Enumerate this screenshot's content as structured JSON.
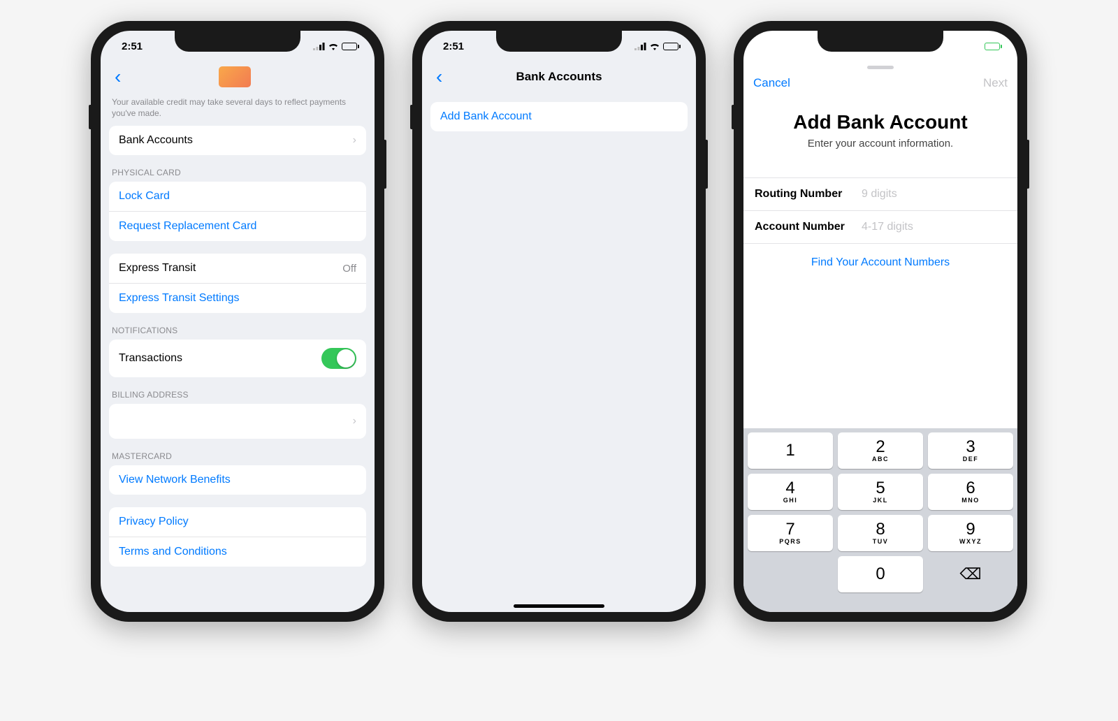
{
  "status": {
    "time": "2:51"
  },
  "screen1": {
    "helper_text": "Your available credit may take several days to reflect payments you've made.",
    "bank_accounts_label": "Bank Accounts",
    "sections": {
      "physical_card_header": "PHYSICAL CARD",
      "lock_card": "Lock Card",
      "request_replacement": "Request Replacement Card",
      "express_transit_label": "Express Transit",
      "express_transit_value": "Off",
      "express_transit_settings": "Express Transit Settings",
      "notifications_header": "NOTIFICATIONS",
      "transactions_label": "Transactions",
      "billing_header": "BILLING ADDRESS",
      "mastercard_header": "MASTERCARD",
      "network_benefits": "View Network Benefits",
      "privacy_policy": "Privacy Policy",
      "terms": "Terms and Conditions"
    }
  },
  "screen2": {
    "title": "Bank Accounts",
    "add_label": "Add Bank Account"
  },
  "screen3": {
    "cancel": "Cancel",
    "next": "Next",
    "title": "Add Bank Account",
    "subtitle": "Enter your account information.",
    "routing_label": "Routing Number",
    "routing_placeholder": "9 digits",
    "account_label": "Account Number",
    "account_placeholder": "4-17 digits",
    "help_link": "Find Your Account Numbers",
    "keypad": [
      {
        "num": "1",
        "sub": ""
      },
      {
        "num": "2",
        "sub": "ABC"
      },
      {
        "num": "3",
        "sub": "DEF"
      },
      {
        "num": "4",
        "sub": "GHI"
      },
      {
        "num": "5",
        "sub": "JKL"
      },
      {
        "num": "6",
        "sub": "MNO"
      },
      {
        "num": "7",
        "sub": "PQRS"
      },
      {
        "num": "8",
        "sub": "TUV"
      },
      {
        "num": "9",
        "sub": "WXYZ"
      },
      {
        "num": "",
        "sub": ""
      },
      {
        "num": "0",
        "sub": ""
      },
      {
        "num": "⌫",
        "sub": ""
      }
    ]
  }
}
